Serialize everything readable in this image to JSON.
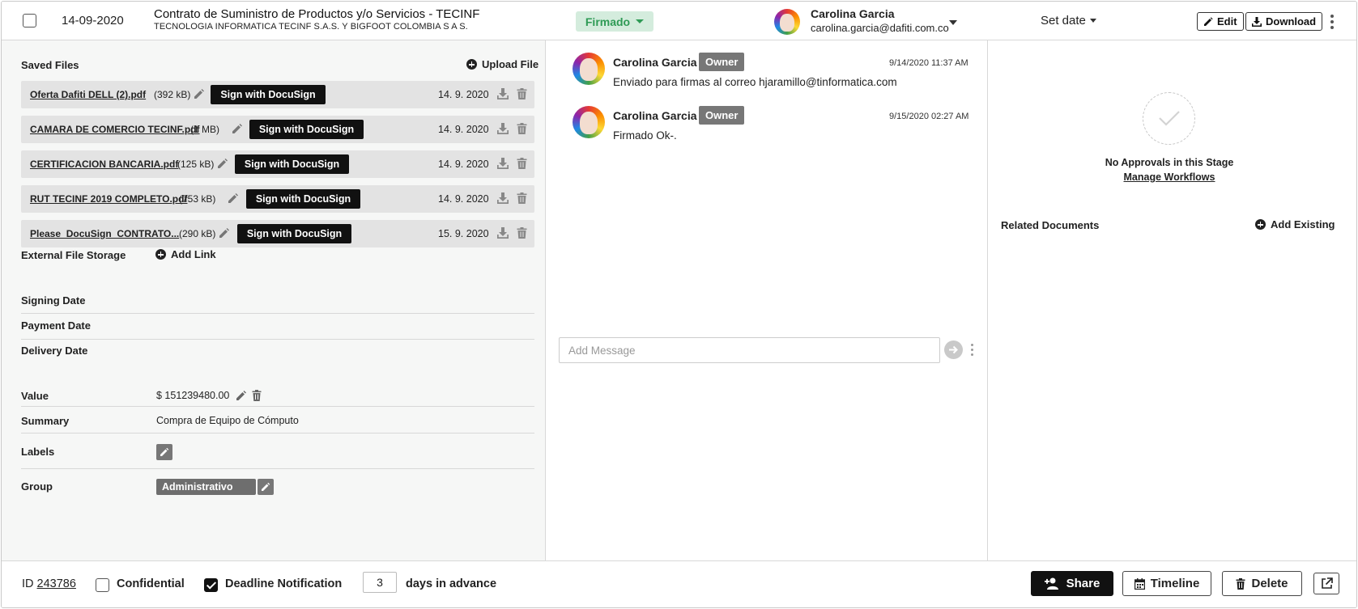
{
  "header": {
    "date": "14-09-2020",
    "title": "Contrato de Suministro de Productos y/o Servicios - TECINF",
    "subtitle": "TECNOLOGIA INFORMATICA TECINF S.A.S. Y BIGFOOT COLOMBIA S A S.",
    "status": "Firmado",
    "status_color": "#2e9a55",
    "user_name": "Carolina Garcia",
    "user_email": "carolina.garcia@dafiti.com.co",
    "set_date": "Set date",
    "edit_label": "Edit",
    "download_label": "Download"
  },
  "files": {
    "title": "Saved Files",
    "upload_label": "Upload File",
    "sign_label": "Sign with DocuSign",
    "items": [
      {
        "name": "Oferta Dafiti DELL (2).pdf",
        "size": "(392 kB)",
        "date": "14. 9. 2020"
      },
      {
        "name": "CAMARA DE COMERCIO TECINF.pdf",
        "size": "(1 MB)",
        "date": "14. 9. 2020"
      },
      {
        "name": "CERTIFICACION BANCARIA.pdf",
        "size": "(125 kB)",
        "date": "14. 9. 2020"
      },
      {
        "name": "RUT TECINF 2019 COMPLETO.pdf",
        "size": "(753 kB)",
        "date": "14. 9. 2020"
      },
      {
        "name": "Please_DocuSign_CONTRATO...",
        "size": "(290 kB)",
        "date": "15. 9. 2020"
      }
    ],
    "external_label": "External File Storage",
    "add_link_label": "Add Link"
  },
  "dates": {
    "signing": "Signing Date",
    "payment": "Payment Date",
    "delivery": "Delivery Date"
  },
  "fields": {
    "value_label": "Value",
    "value": "$ 151239480.00",
    "summary_label": "Summary",
    "summary": "Compra de Equipo de Cómputo",
    "labels_label": "Labels",
    "group_label": "Group",
    "group": "Administrativo"
  },
  "messages": {
    "items": [
      {
        "author": "Carolina Garcia",
        "role": "Owner",
        "time": "9/14/2020 11:37 AM",
        "text": "Enviado para firmas al correo hjaramillo@tinformatica.com"
      },
      {
        "author": "Carolina Garcia",
        "role": "Owner",
        "time": "9/15/2020 02:27 AM",
        "text": "Firmado Ok-."
      }
    ],
    "placeholder": "Add Message"
  },
  "approvals": {
    "none": "No Approvals in this Stage",
    "manage": "Manage Workflows"
  },
  "related": {
    "title": "Related Documents",
    "add_label": "Add Existing"
  },
  "footer": {
    "id_label": "ID",
    "id_value": "243786",
    "confidential": "Confidential",
    "deadline": "Deadline Notification",
    "days_value": "3",
    "days_suffix": "days in advance",
    "share": "Share",
    "timeline": "Timeline",
    "delete": "Delete"
  }
}
